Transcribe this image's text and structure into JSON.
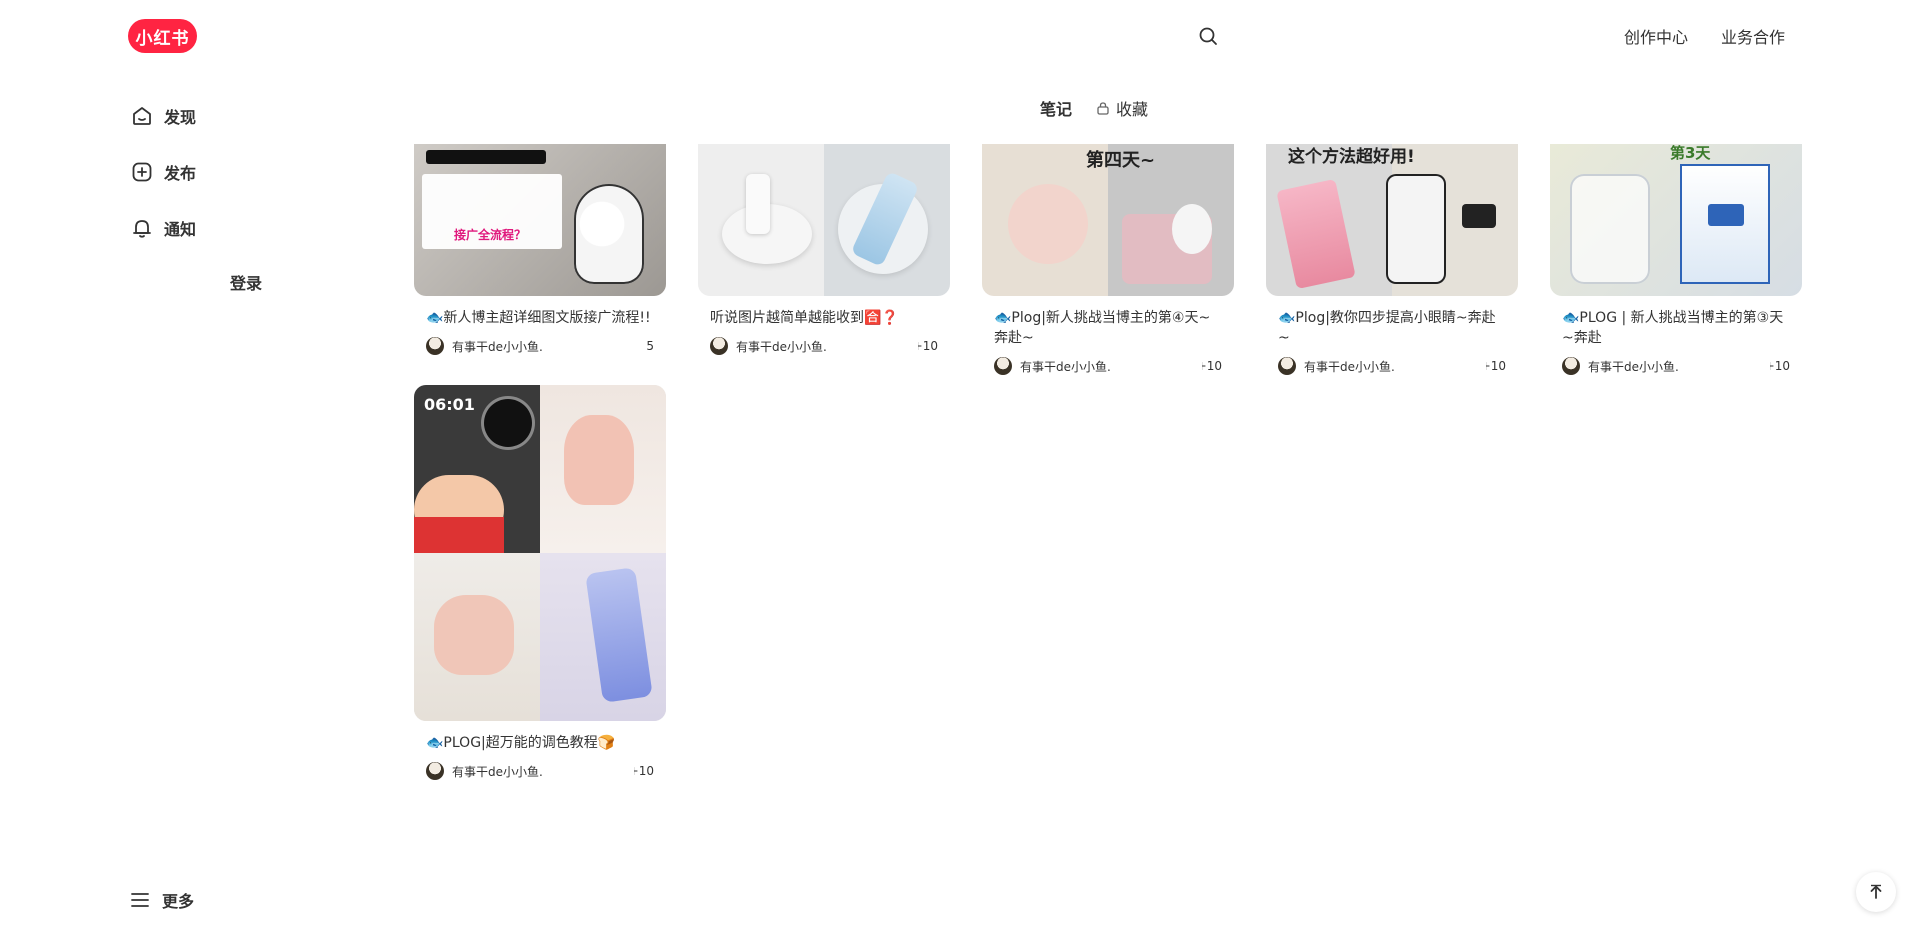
{
  "header": {
    "logo_text": "小红书",
    "links": [
      "创作中心",
      "业务合作"
    ]
  },
  "sidebar": {
    "items": [
      {
        "label": "发现",
        "icon": "discover-icon"
      },
      {
        "label": "发布",
        "icon": "publish-icon"
      },
      {
        "label": "通知",
        "icon": "bell-icon"
      }
    ],
    "login_label": "登录",
    "more_label": "更多"
  },
  "tabs": [
    {
      "label": "笔记",
      "active": true
    },
    {
      "label": "收藏",
      "active": false,
      "icon": "lock-icon"
    }
  ],
  "notes": [
    {
      "title": "🐟新人博主超详细图文版接广流程!!",
      "author": "有事干de小小鱼.",
      "likes": "5",
      "overlay": "接广全流程？"
    },
    {
      "title": "听说图片越简单越能收到🈴❓",
      "author": "有事干de小小鱼.",
      "likes": "10+",
      "overlay": ""
    },
    {
      "title": "🐟Plog|新人挑战当博主的第④天~奔赴~",
      "author": "有事干de小小鱼.",
      "likes": "10+",
      "overlay": "第四天~"
    },
    {
      "title": "🐟Plog|教你四步提高小眼睛~奔赴~",
      "author": "有事干de小小鱼.",
      "likes": "10+",
      "overlay": "这个方法超好用!"
    },
    {
      "title": "🐟PLOG | 新人挑战当博主的第③天~奔赴",
      "author": "有事干de小小鱼.",
      "likes": "10+",
      "overlay": "第3天"
    },
    {
      "title": "🐟PLOG|超万能的调色教程🍞",
      "author": "有事干de小小鱼.",
      "likes": "10+",
      "overlay": "06:01"
    }
  ],
  "colors": {
    "brand": "#ff2442",
    "text": "#333333"
  }
}
